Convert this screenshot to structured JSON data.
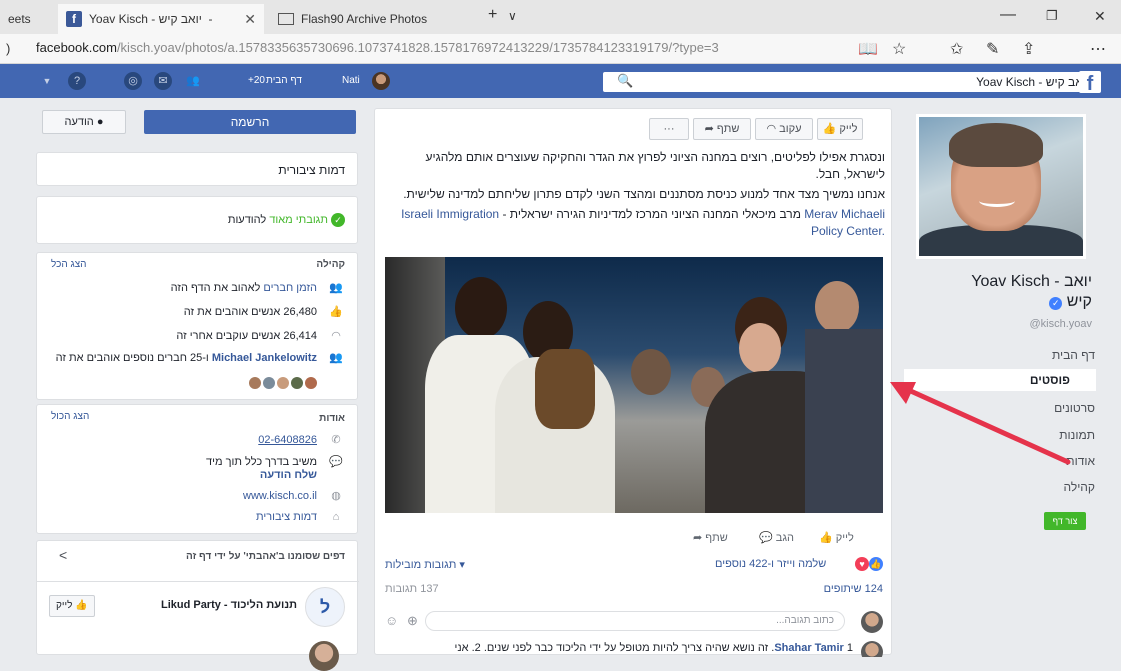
{
  "browser": {
    "tabs": [
      {
        "label": "eets"
      },
      {
        "label": "Yoav Kisch - יואב קיש ‎‏ - ‎"
      },
      {
        "label": "Flash90 Archive Photos"
      }
    ],
    "new_tab": "+",
    "tab_menu": "∨",
    "url_host": "facebook.com",
    "url_path": "/kisch.yoav/photos/a.1578335635730696.1073741828.1578176972413229/1735784123319179/?type=3",
    "window_controls": {
      "minimize": "—",
      "restore": "❐",
      "close": "✕"
    }
  },
  "fbbar": {
    "search_value": "יואב קיש - Yoav Kisch",
    "home_label": "דף הבית",
    "home_count": "+20",
    "user_name": "Nati"
  },
  "left_menu": {
    "name_line1": "יואב - Yoav Kisch",
    "name_line2": "קיש",
    "handle": "@kisch.yoav",
    "items": [
      {
        "label": "דף הבית"
      },
      {
        "label": "פוסטים"
      },
      {
        "label": "סרטונים"
      },
      {
        "label": "תמונות"
      },
      {
        "label": "אודות"
      },
      {
        "label": "קהילה"
      }
    ],
    "create_page": "צור דף"
  },
  "post": {
    "buttons": {
      "like": "לייק",
      "follow": "עקוב",
      "share": "שתף",
      "more": "···"
    },
    "paragraph1": "ונסגרת אפילו לפליטים, רוצים במחנה הציוני לפרוץ את הגדר והחקיקה שעוצרים אותם מלהגיע לישראל, חבל.",
    "paragraph2": "אנחנו נמשיך מצד אחד למנוע כניסת מסתננים ומהצד השני לקדם פתרון שליחתם למדינה שלישית.",
    "link_name": "Merav Michaeli",
    "link_text1": "מרב מיכאלי המחנה הציוני המרכז למדיניות הגירה ישראלית -",
    "link_name2": "Israeli",
    "link_text2": "Immigration Policy Center.",
    "actions": {
      "like": "לייק",
      "comment": "הגב",
      "share": "שתף"
    },
    "reactions_text": "שלמה וייזר ו-422 נוספים",
    "top_comments": "תגובות מובילות ▾",
    "shares": "124 שיתופים",
    "comments_count": "137 תגובות",
    "write_comment": "כתוב תגובה...",
    "comment_author": "Shahar Tamir",
    "comment_text": "1. זה נושא שהיה צריך להיות מטופל על ידי הליכוד כבר לפני שנים. 2. אני"
  },
  "right_col": {
    "send_message": "הודעה",
    "signup": "הרשמה",
    "public_figure": "דמות ציבורית",
    "response_text": "תגובתי מאוד",
    "response_suffix": "להודעות",
    "community_title": "קהילה",
    "see_all": "הצג הכל",
    "invite_friends": "הזמן חברים",
    "invite_suffix": "לאהוב את הדף הזה",
    "likes": "26,480 אנשים אוהבים את זה",
    "follows": "26,414 אנשים עוקבים אחרי זה",
    "friends_like_name": "Michael Jankelowitz",
    "friends_like_text": "ו-25 חברים נוספים אוהבים את זה",
    "about_title": "אודות",
    "about_see_all": "הצג הכול",
    "phone": "02-6408826",
    "reply_time": "משיב בדרך כלל תוך מיד",
    "send_message_link": "שלח הודעה",
    "website": "www.kisch.co.il",
    "category": "דמות ציבורית",
    "liked_pages_title": "דפים שסומנו ב'אהבתי' על ידי דף זה",
    "liked_page_name": "תנועת הליכוד - Likud Party",
    "liked_page_like": "לייק"
  },
  "colors": {
    "fb_blue": "#4267b2",
    "link": "#365899",
    "green": "#42b72a",
    "arrow": "#e5334b"
  }
}
